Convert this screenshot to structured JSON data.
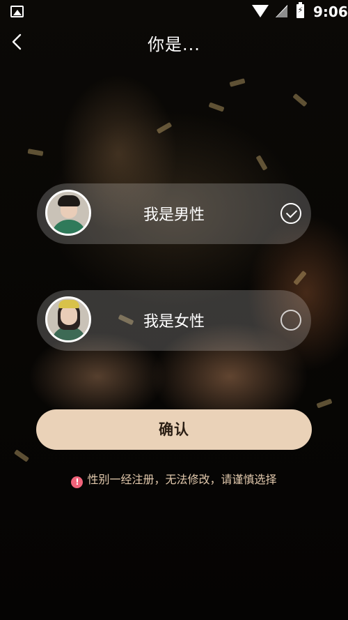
{
  "status_bar": {
    "time": "9:06",
    "icons": [
      "picture-icon",
      "wifi-icon",
      "signal-icon",
      "battery-icon"
    ]
  },
  "header": {
    "title": "你是...",
    "back_icon": "chevron-left-icon"
  },
  "options": [
    {
      "label": "我是男性",
      "selected": true,
      "avatar": "male-avatar"
    },
    {
      "label": "我是女性",
      "selected": false,
      "avatar": "female-avatar"
    }
  ],
  "confirm_label": "确认",
  "notice": {
    "text": "性别一经注册，无法修改，请谨慎选择",
    "icon": "exclamation-icon",
    "icon_glyph": "!"
  },
  "colors": {
    "button_bg": "#ead2b8",
    "notice_text": "#e2c9ad",
    "warn_icon": "#f0637a"
  }
}
